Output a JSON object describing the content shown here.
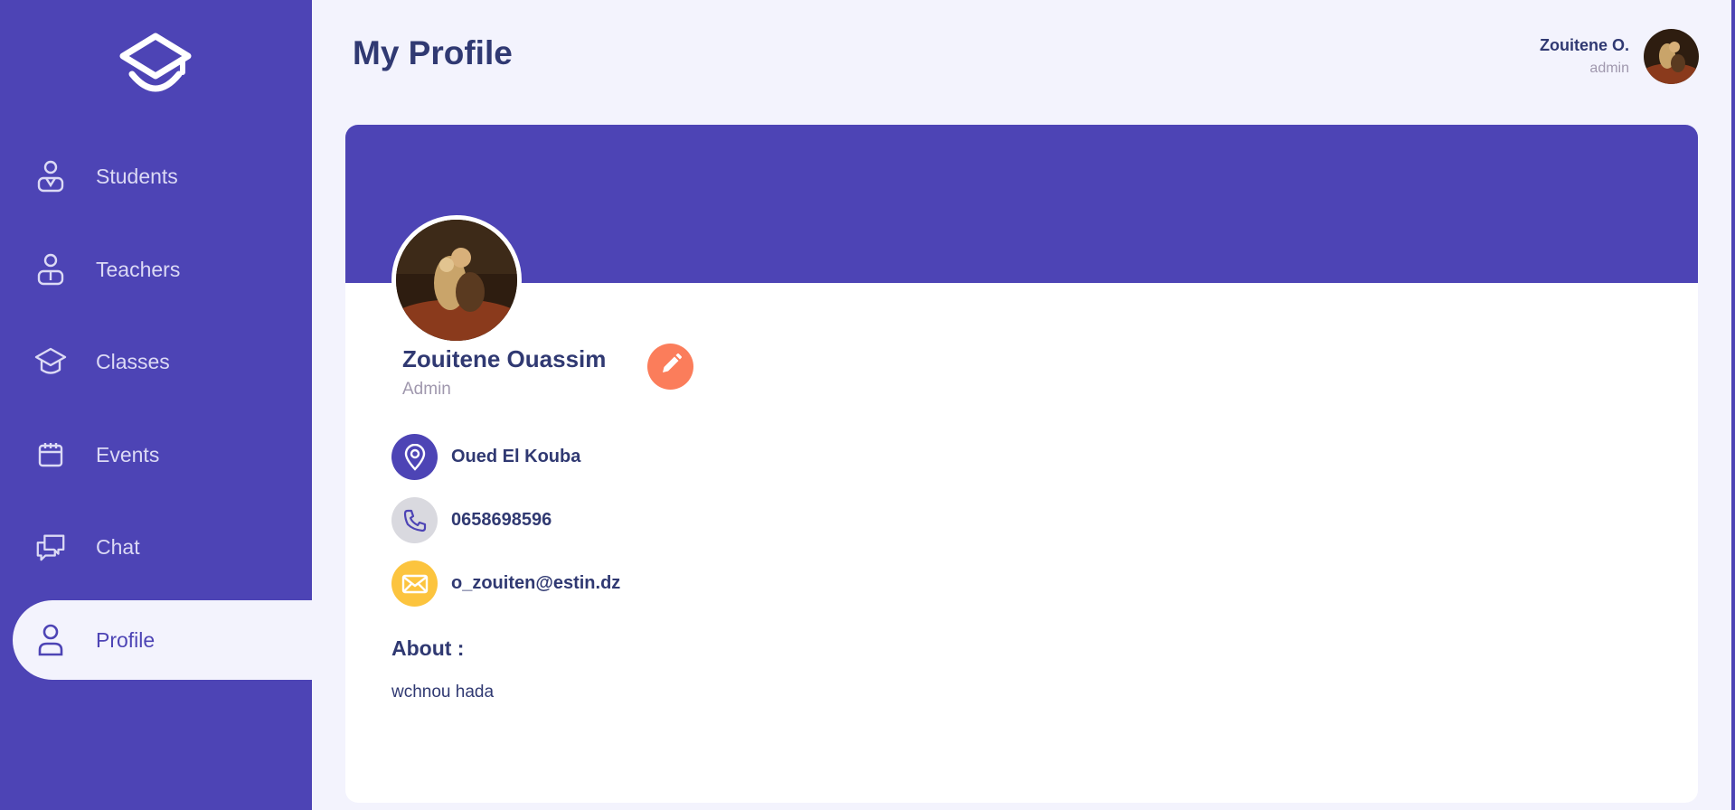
{
  "sidebar": {
    "logo_icon": "graduation-cap-icon",
    "items": [
      {
        "label": "Students",
        "icon": "student-icon",
        "active": false
      },
      {
        "label": "Teachers",
        "icon": "teacher-icon",
        "active": false
      },
      {
        "label": "Classes",
        "icon": "graduation-cap-icon",
        "active": false
      },
      {
        "label": "Events",
        "icon": "calendar-icon",
        "active": false
      },
      {
        "label": "Chat",
        "icon": "chat-icon",
        "active": false
      },
      {
        "label": "Profile",
        "icon": "user-icon",
        "active": true
      }
    ]
  },
  "header": {
    "title": "My Profile",
    "user_name": "Zouitene O.",
    "user_role": "admin"
  },
  "profile": {
    "name": "Zouitene Ouassim",
    "role": "Admin",
    "location": "Oued El Kouba",
    "phone": "0658698596",
    "email": "o_zouiten@estin.dz",
    "about_title": "About :",
    "about_text": "wchnou hada"
  },
  "colors": {
    "primary": "#4d44b5",
    "background": "#f3f3fd",
    "text_dark": "#303972",
    "text_muted": "#a098ae",
    "edit_orange": "#fb7d5b",
    "phone_gray": "#d9d9df",
    "email_yellow": "#fcc43e"
  }
}
